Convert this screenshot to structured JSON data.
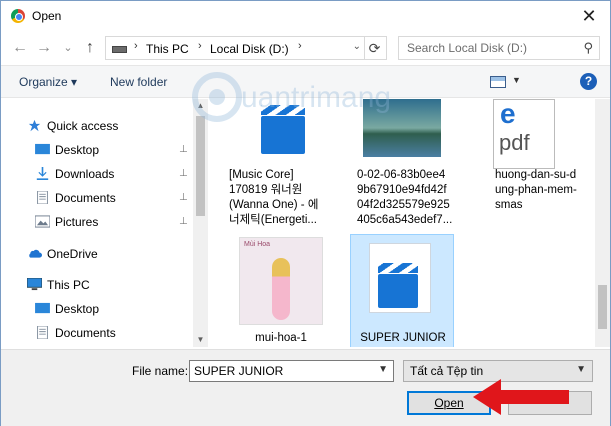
{
  "window": {
    "title": "Open",
    "close_glyph": "✕"
  },
  "nav": {
    "back": "←",
    "forward": "→",
    "recent": "⌄",
    "up": "↑",
    "path": [
      "This PC",
      "Local Disk (D:)"
    ],
    "dropdown_glyph": "⌄",
    "refresh_glyph": "⟳",
    "search_placeholder": "Search Local Disk (D:)"
  },
  "toolbar": {
    "organize": "Organize ▾",
    "new_folder": "New folder",
    "help": "?"
  },
  "sidebar": {
    "items": [
      {
        "label": "Quick access",
        "icon": "star-icon",
        "pinned": false
      },
      {
        "label": "Desktop",
        "icon": "desktop-icon",
        "pinned": true
      },
      {
        "label": "Downloads",
        "icon": "download-icon",
        "pinned": true
      },
      {
        "label": "Documents",
        "icon": "documents-icon",
        "pinned": true
      },
      {
        "label": "Pictures",
        "icon": "pictures-icon",
        "pinned": true
      },
      {
        "label": "OneDrive",
        "icon": "cloud-icon",
        "pinned": false
      },
      {
        "label": "This PC",
        "icon": "computer-icon",
        "pinned": false
      },
      {
        "label": "Desktop",
        "icon": "desktop-icon",
        "pinned": false
      },
      {
        "label": "Documents",
        "icon": "documents-icon",
        "pinned": false
      }
    ],
    "pin_glyph": "📌"
  },
  "files": [
    {
      "name_lines": [
        "[Music Core]",
        "170819 워너원",
        "(Wanna One) - 에",
        "너제틱(Energeti..."
      ],
      "kind": "video"
    },
    {
      "name_lines": [
        "0-02-06-83b0ee4",
        "9b67910e94fd42f",
        "04f2d325579e925",
        "405c6a543edef7..."
      ],
      "kind": "image"
    },
    {
      "name_lines": [
        "huong-dan-su-d",
        "ung-phan-mem-",
        "smas"
      ],
      "kind": "pdf",
      "pdf_label": "pdf"
    },
    {
      "name_lines": [
        "mui-hoa-1"
      ],
      "kind": "photo",
      "photo_caption": "Mùi Hoa"
    },
    {
      "name_lines": [
        "SUPER JUNIOR"
      ],
      "kind": "video",
      "selected": true
    }
  ],
  "bottom": {
    "file_name_label": "File name:",
    "file_name_value": "SUPER JUNIOR",
    "file_type": "Tất cả Tệp tin",
    "open": "Open",
    "cancel": ""
  },
  "watermark": "Quantrimang"
}
